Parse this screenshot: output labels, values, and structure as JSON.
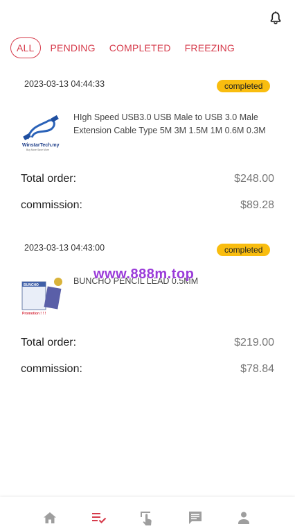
{
  "tabs": [
    {
      "label": "ALL",
      "active": true
    },
    {
      "label": "PENDING"
    },
    {
      "label": "COMPLETED"
    },
    {
      "label": "FREEZING"
    }
  ],
  "orders": [
    {
      "date": "2023-03-13 04:44:33",
      "status": "completed",
      "product_name": "HIgh Speed USB3.0 USB Male to USB 3.0 Male Extension Cable Type 5M 3M 1.5M 1M 0.6M 0.3M",
      "thumb_brand": "WinstarTech.my",
      "thumb_tagline": "Buy More Save More",
      "total_label": "Total order:",
      "total_value": "$248.00",
      "commission_label": "commission:",
      "commission_value": "$89.28"
    },
    {
      "date": "2023-03-13 04:43:00",
      "status": "completed",
      "product_name": "BUNCHO PENCIL LEAD 0.5MM",
      "thumb_brand": "BUNCHO",
      "thumb_tagline": "Promotion ! ! !",
      "total_label": "Total order:",
      "total_value": "$219.00",
      "commission_label": "commission:",
      "commission_value": "$78.84"
    }
  ],
  "watermark": "www.888m.top",
  "colors": {
    "accent": "#d63b4b",
    "badge": "#f9bd0f",
    "watermark": "#9a3bd9",
    "nav_inactive": "#9e9e9e"
  },
  "nav": [
    {
      "icon": "home-icon",
      "active": false
    },
    {
      "icon": "order-list-icon",
      "active": true
    },
    {
      "icon": "tap-hand-icon",
      "active": false
    },
    {
      "icon": "chat-icon",
      "active": false
    },
    {
      "icon": "profile-icon",
      "active": false
    }
  ]
}
